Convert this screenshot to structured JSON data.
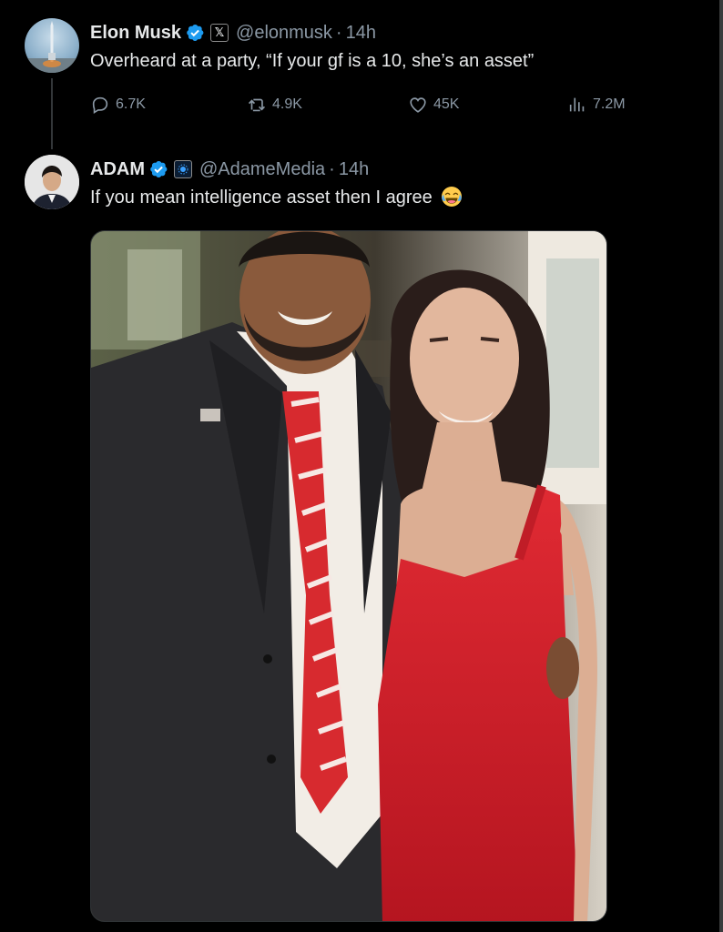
{
  "tweet1": {
    "display_name": "Elon Musk",
    "badge_symbol": "𝕏",
    "handle": "@elonmusk",
    "separator": "·",
    "time": "14h",
    "text": "Overheard at a party, “If your gf is a 10, she’s an asset”",
    "actions": {
      "replies": "6.7K",
      "reposts": "4.9K",
      "likes": "45K",
      "views": "7.2M"
    }
  },
  "tweet2": {
    "display_name": "ADAM",
    "handle": "@AdameMedia",
    "separator": "·",
    "time": "14h",
    "text": "If you mean intelligence asset then I agree",
    "emoji": "face-with-tears-of-joy"
  },
  "colors": {
    "background": "#000000",
    "text_primary": "#e7e9ea",
    "text_secondary": "#8b98a5",
    "verified_blue": "#1d9bf0",
    "dress_red": "#d6202b"
  },
  "icons": [
    "reply-icon",
    "repost-icon",
    "like-icon",
    "views-icon",
    "verified-badge-icon"
  ]
}
